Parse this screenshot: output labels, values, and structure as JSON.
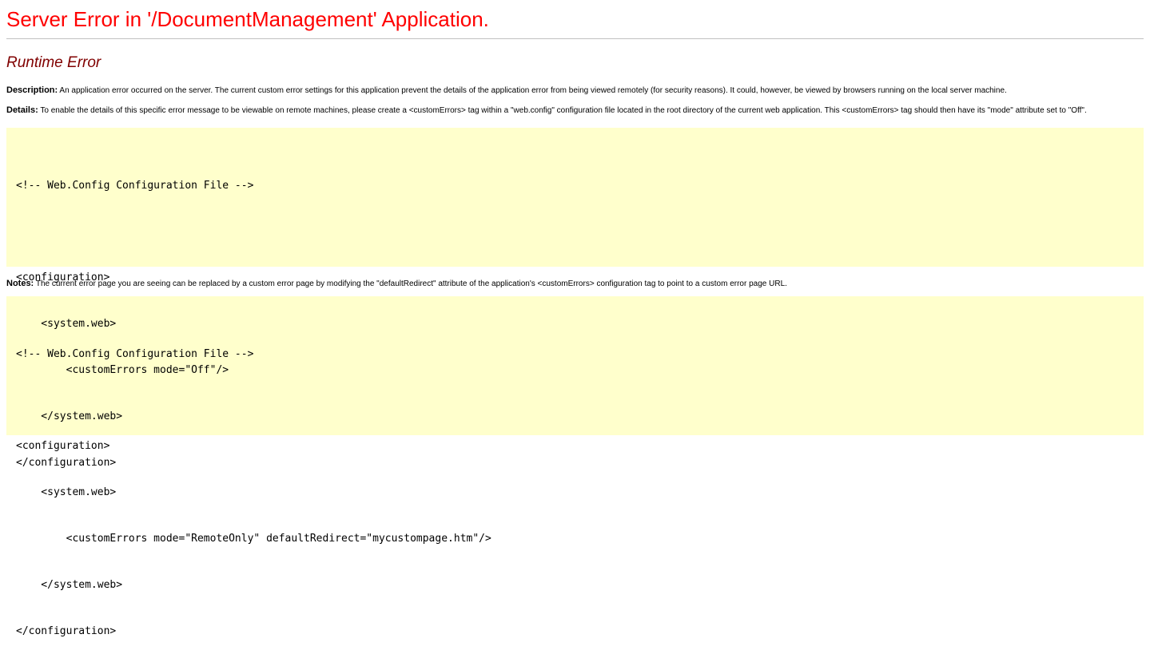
{
  "title": "Server Error in '/DocumentManagement' Application.",
  "subtitle": "Runtime Error",
  "description": {
    "label": "Description:",
    "text": " An application error occurred on the server. The current custom error settings for this application prevent the details of the application error from being viewed remotely (for security reasons). It could, however, be viewed by browsers running on the local server machine."
  },
  "details": {
    "label": "Details:",
    "text": " To enable the details of this specific error message to be viewable on remote machines, please create a <customErrors> tag within a \"web.config\" configuration file located in the root directory of the current web application. This <customErrors> tag should then have its \"mode\" attribute set to \"Off\"."
  },
  "code1": {
    "lines": [
      "<!-- Web.Config Configuration File -->",
      "",
      "<configuration>",
      "    <system.web>",
      "        <customErrors mode=\"Off\"/>",
      "    </system.web>",
      "</configuration>"
    ]
  },
  "notes": {
    "label": "Notes:",
    "text": " The current error page you are seeing can be replaced by a custom error page by modifying the \"defaultRedirect\" attribute of the application's <customErrors> configuration tag to point to a custom error page URL."
  },
  "code2": {
    "lines": [
      "<!-- Web.Config Configuration File -->",
      "",
      "<configuration>",
      "    <system.web>",
      "        <customErrors mode=\"RemoteOnly\" defaultRedirect=\"mycustompage.htm\"/>",
      "    </system.web>",
      "</configuration>"
    ]
  },
  "colors": {
    "title": "#ff0000",
    "subtitle": "#800000",
    "code_background": "#ffffcc",
    "rule": "#c0c0c0"
  }
}
